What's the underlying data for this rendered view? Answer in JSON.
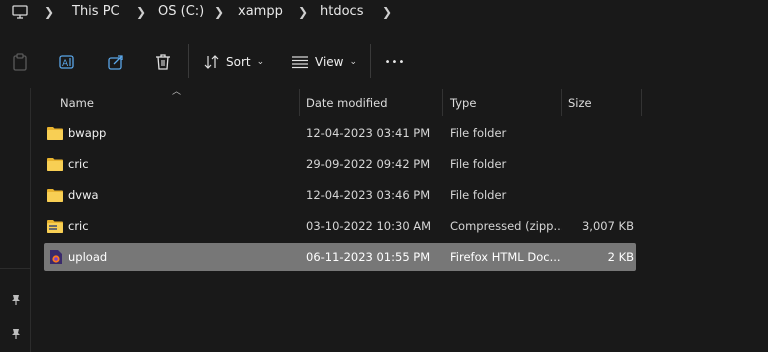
{
  "breadcrumb": {
    "items": [
      "This PC",
      "OS (C:)",
      "xampp",
      "htdocs"
    ]
  },
  "toolbar": {
    "sort_label": "Sort",
    "view_label": "View",
    "more_label": "•••"
  },
  "columns": {
    "name": "Name",
    "date": "Date modified",
    "type": "Type",
    "size": "Size"
  },
  "files": [
    {
      "name": "bwapp",
      "date": "12-04-2023 03:41 PM",
      "type": "File folder",
      "size": "",
      "icon": "folder-icon"
    },
    {
      "name": "cric",
      "date": "29-09-2022 09:42 PM",
      "type": "File folder",
      "size": "",
      "icon": "folder-icon"
    },
    {
      "name": "dvwa",
      "date": "12-04-2023 03:46 PM",
      "type": "File folder",
      "size": "",
      "icon": "folder-icon"
    },
    {
      "name": "cric",
      "date": "03-10-2022 10:30 AM",
      "type": "Compressed (zipp...",
      "size": "3,007 KB",
      "icon": "zip-folder-icon"
    },
    {
      "name": "upload",
      "date": "06-11-2023 01:55 PM",
      "type": "Firefox HTML Doc...",
      "size": "2 KB",
      "icon": "firefox-html-icon",
      "selected": true
    }
  ],
  "colors": {
    "background": "#191919",
    "selection": "#777777",
    "folder": "#f4c742"
  }
}
